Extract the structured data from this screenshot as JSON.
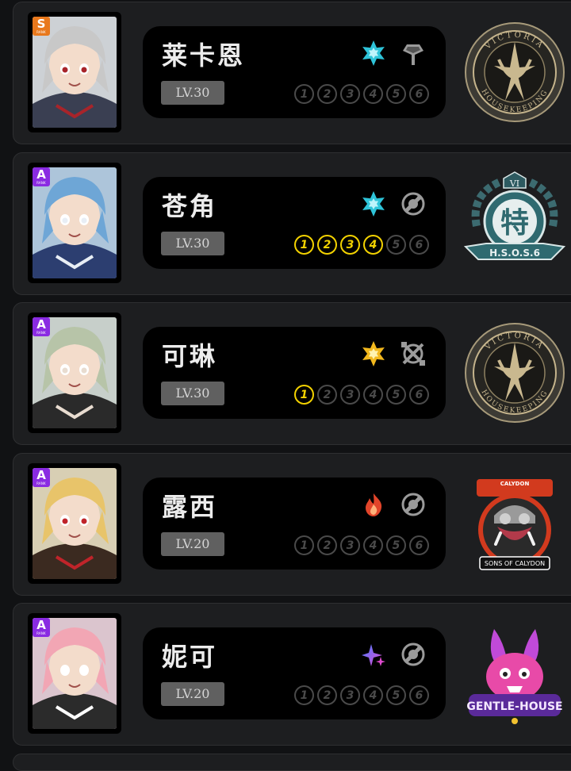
{
  "agents": [
    {
      "name": "莱卡恩",
      "level": "LV.30",
      "rank": "S",
      "rank_sub": "RANK",
      "rank_color": "#e8781c",
      "attribute_icon": "ice-star-icon",
      "attribute_color": "#2ec4d9",
      "specialty_icon": "stun-axe-icon",
      "mindscape_unlocked": 0,
      "mindscape": [
        "1",
        "2",
        "3",
        "4",
        "5",
        "6"
      ],
      "faction": "Victoria Housekeeping",
      "faction_top": "VICTORIA",
      "faction_bottom": "HOUSEKEEPING",
      "palette": [
        "#c8c8c8",
        "#3a3f52",
        "#a8242a"
      ]
    },
    {
      "name": "苍角",
      "level": "LV.30",
      "rank": "A",
      "rank_sub": "RANK",
      "rank_color": "#8a2be2",
      "attribute_icon": "ice-star-icon",
      "attribute_color": "#2ec4d9",
      "specialty_icon": "support-icon",
      "mindscape_unlocked": 4,
      "mindscape": [
        "1",
        "2",
        "3",
        "4",
        "5",
        "6"
      ],
      "faction": "H.S.O.S.6",
      "faction_roman": "VI",
      "faction_char": "特",
      "faction_label": "H.S.O.S.6",
      "palette": [
        "#6ea6d6",
        "#2c3e70",
        "#e8eef5"
      ]
    },
    {
      "name": "可琳",
      "level": "LV.30",
      "rank": "A",
      "rank_sub": "RANK",
      "rank_color": "#8a2be2",
      "attribute_icon": "physical-star-icon",
      "attribute_color": "#f2b81d",
      "specialty_icon": "attack-swords-icon",
      "mindscape_unlocked": 1,
      "mindscape": [
        "1",
        "2",
        "3",
        "4",
        "5",
        "6"
      ],
      "faction": "Victoria Housekeeping",
      "faction_top": "VICTORIA",
      "faction_bottom": "HOUSEKEEPING",
      "palette": [
        "#b7c4a8",
        "#2a2a2a",
        "#e8dcd0"
      ]
    },
    {
      "name": "露西",
      "level": "LV.20",
      "rank": "A",
      "rank_sub": "RANK",
      "rank_color": "#8a2be2",
      "attribute_icon": "fire-icon",
      "attribute_color": "#e2452a",
      "specialty_icon": "support-icon",
      "mindscape_unlocked": 0,
      "mindscape": [
        "1",
        "2",
        "3",
        "4",
        "5",
        "6"
      ],
      "faction": "Sons of Calydon",
      "faction_top": "CALYDON",
      "faction_bottom": "SONS OF CALYDON",
      "palette": [
        "#e8c46a",
        "#3b2a20",
        "#c0242a"
      ]
    },
    {
      "name": "妮可",
      "level": "LV.20",
      "rank": "A",
      "rank_sub": "RANK",
      "rank_color": "#8a2be2",
      "attribute_icon": "ether-sparkle-icon",
      "attribute_color": "#5a7cff",
      "specialty_icon": "support-icon",
      "mindscape_unlocked": 0,
      "mindscape": [
        "1",
        "2",
        "3",
        "4",
        "5",
        "6"
      ],
      "faction": "Gentle House",
      "faction_label": "GENTLE-HOUSE",
      "palette": [
        "#f2a6b4",
        "#2b2b2b",
        "#ffffff"
      ]
    }
  ]
}
